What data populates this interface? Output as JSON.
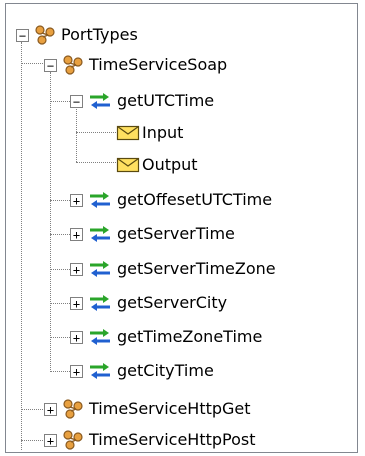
{
  "tree": {
    "root": {
      "label": "PortTypes",
      "icon": "porttype-icon",
      "expanded": true
    },
    "soap": {
      "label": "TimeServiceSoap",
      "icon": "porttype-icon",
      "expanded": true
    },
    "getutc": {
      "label": "getUTCTime",
      "icon": "operation-icon",
      "expanded": true
    },
    "input": {
      "label": "Input",
      "icon": "message-icon"
    },
    "output": {
      "label": "Output",
      "icon": "message-icon"
    },
    "ops": [
      {
        "label": "getOffesetUTCTime",
        "icon": "operation-icon",
        "expanded": false
      },
      {
        "label": "getServerTime",
        "icon": "operation-icon",
        "expanded": false
      },
      {
        "label": "getServerTimeZone",
        "icon": "operation-icon",
        "expanded": false
      },
      {
        "label": "getServerCity",
        "icon": "operation-icon",
        "expanded": false
      },
      {
        "label": "getTimeZoneTime",
        "icon": "operation-icon",
        "expanded": false
      },
      {
        "label": "getCityTime",
        "icon": "operation-icon",
        "expanded": false
      }
    ],
    "httpget": {
      "label": "TimeServiceHttpGet",
      "icon": "porttype-icon",
      "expanded": false
    },
    "httppost": {
      "label": "TimeServiceHttpPost",
      "icon": "porttype-icon",
      "expanded": false
    },
    "expand_symbol": "+",
    "collapse_symbol": "−",
    "colors": {
      "porttype_orange": "#e8a040",
      "porttype_brown": "#8a5a20",
      "op_green": "#2aa52a",
      "op_blue": "#2060d0",
      "message_yellow": "#ffe060",
      "lines": "#808080"
    }
  }
}
